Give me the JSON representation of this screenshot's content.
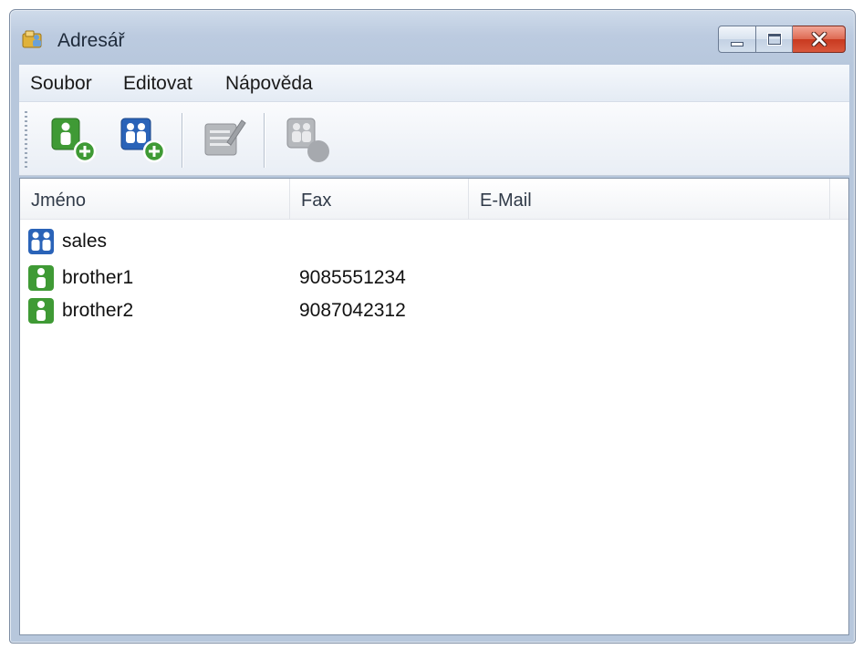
{
  "window": {
    "title": "Adresář",
    "icon": "address-book-icon"
  },
  "menu": [
    {
      "label": "Soubor"
    },
    {
      "label": "Editovat"
    },
    {
      "label": "Nápověda"
    }
  ],
  "toolbar": {
    "tools": [
      {
        "icon": "add-contact-icon",
        "enabled": true
      },
      {
        "icon": "add-group-icon",
        "enabled": true
      },
      {
        "icon": "edit-entry-icon",
        "enabled": false
      },
      {
        "icon": "delete-entry-icon",
        "enabled": false
      }
    ]
  },
  "list": {
    "columns": [
      "Jméno",
      "Fax",
      "E-Mail"
    ],
    "rows": [
      {
        "type": "group",
        "icon": "group-icon",
        "name": "sales",
        "fax": "",
        "email": ""
      },
      {
        "type": "contact",
        "icon": "contact-icon",
        "name": "brother1",
        "fax": "9085551234",
        "email": ""
      },
      {
        "type": "contact",
        "icon": "contact-icon",
        "name": "brother2",
        "fax": "9087042312",
        "email": ""
      }
    ]
  },
  "colors": {
    "contact_green": "#3f9a35",
    "group_blue": "#2a63b8",
    "close_red": "#d24a30"
  }
}
